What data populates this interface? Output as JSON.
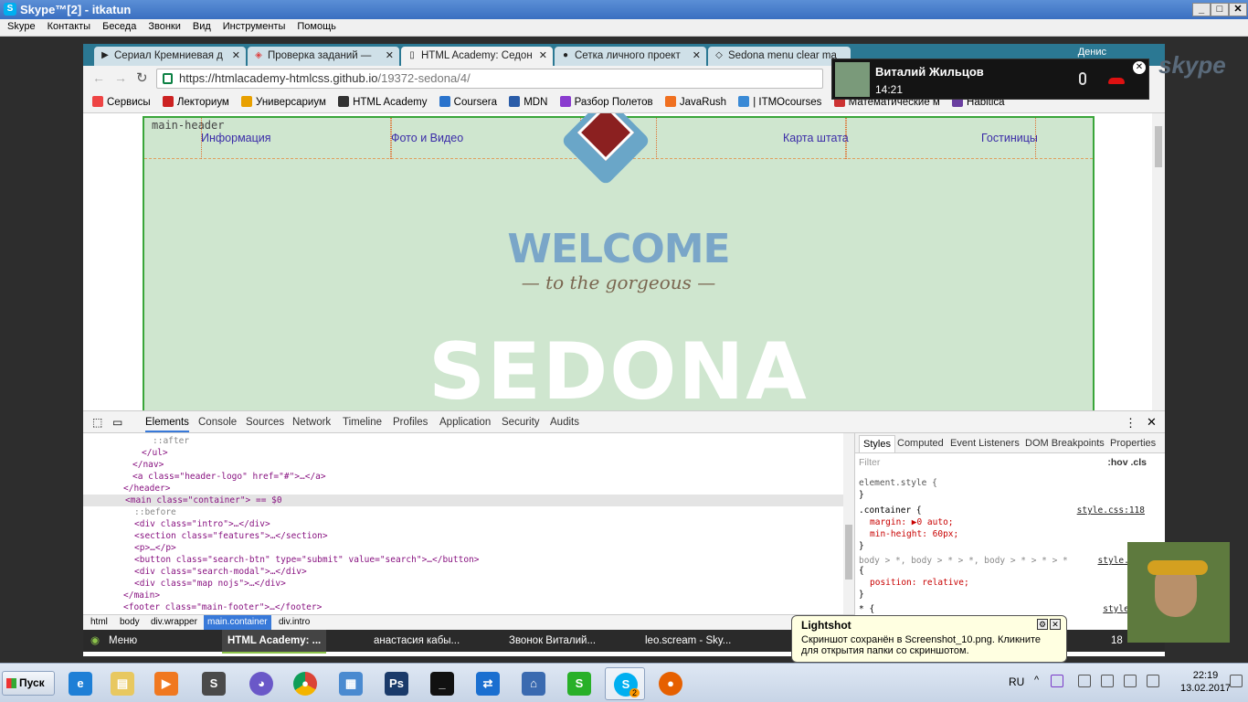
{
  "skype": {
    "title": "Skype™[2] - itkatun",
    "logo_letter": "S",
    "menu": [
      "Skype",
      "Контакты",
      "Беседа",
      "Звонки",
      "Вид",
      "Инструменты",
      "Помощь"
    ],
    "call": {
      "name": "Виталий Жильцов",
      "time": "14:21"
    },
    "logo_text": "skype"
  },
  "chrome": {
    "tabs": [
      {
        "label": "Сериал Кремниевая д",
        "icon": "play-icon"
      },
      {
        "label": "Проверка заданий —",
        "icon": "shield-icon"
      },
      {
        "label": "HTML Academy: Седон",
        "icon": "doc-icon",
        "active": true
      },
      {
        "label": "Сетка личного проект",
        "icon": "github-icon"
      },
      {
        "label": "Sedona menu clear ma",
        "icon": "codepen-icon"
      }
    ],
    "profile": "Денис",
    "url_main": "https://htmlacademy-htmlcss.github.io",
    "url_rest": "/19372-sedona/4/",
    "bookmarks": [
      {
        "label": "Сервисы",
        "color": "#e44"
      },
      {
        "label": "Лекториум",
        "color": "#c22"
      },
      {
        "label": "Универсариум",
        "color": "#e8a000"
      },
      {
        "label": "HTML Academy",
        "color": "#333"
      },
      {
        "label": "Coursera",
        "color": "#2a73cc"
      },
      {
        "label": "MDN",
        "color": "#2a5ca8"
      },
      {
        "label": "Разбор Полетов",
        "color": "#8a3ccf"
      },
      {
        "label": "JavaRush",
        "color": "#f07020"
      },
      {
        "label": "| ITMOcourses",
        "color": "#3a8ad6"
      },
      {
        "label": "Математические м",
        "color": "#c33"
      },
      {
        "label": "Habitica",
        "color": "#6a3fa0"
      }
    ]
  },
  "page": {
    "header_label": "main-header",
    "nav": [
      "Информация",
      "Фото и Видео",
      "Карта штата",
      "Гостиницы"
    ],
    "welcome": "WELCOME",
    "gorgeous": "— to the gorgeous —",
    "sedona": "SEDONA"
  },
  "devtools": {
    "tabs": [
      "Elements",
      "Console",
      "Sources",
      "Network",
      "Timeline",
      "Profiles",
      "Application",
      "Security",
      "Audits"
    ],
    "lines": [
      "::after",
      "</ul>",
      "</nav>",
      "<a class=\"header-logo\" href=\"#\">…</a>",
      "</header>",
      "<main class=\"container\"> == $0",
      "::before",
      "<div class=\"intro\">…</div>",
      "<section class=\"features\">…</section>",
      "<p>…</p>",
      "<button class=\"search-btn\" type=\"submit\" value=\"search\">…</button>",
      "<div class=\"search-modal\">…</div>",
      "<div class=\"map nojs\">…</div>",
      "</main>",
      "<footer class=\"main-footer\">…</footer>"
    ],
    "breadcrumbs": [
      "html",
      "body",
      "div.wrapper",
      "main.container",
      "div.intro"
    ],
    "styles_tabs": [
      "Styles",
      "Computed",
      "Event Listeners",
      "DOM Breakpoints",
      "Properties"
    ],
    "filter_placeholder": "Filter",
    "filter_buttons": ":hov  .cls",
    "rules": {
      "element_style": "element.style {",
      "container_sel": ".container {",
      "container_src": "style.css:118",
      "margin": "margin: ▶0 auto;",
      "min_height": "min-height: 60px;",
      "body_sel": "body > *, body > * > *, body > * > * > *",
      "body_src": "style.css",
      "position": "position: relative;",
      "star": "* {",
      "star_src": "style.cs"
    }
  },
  "inner_taskbar": [
    "Меню",
    "HTML Academy: ...",
    "анастасия кабы...",
    "Звонок Виталий...",
    "leo.scream - Sky...",
    "18"
  ],
  "lightshot": {
    "title": "Lightshot",
    "text": "Скриншот сохранён в Screenshot_10.png. Кликните для открытия папки со скриншотом."
  },
  "taskbar": {
    "start": "Пуск",
    "lang": "RU",
    "time": "22:19",
    "date": "13.02.2017",
    "skype_badge": "2"
  }
}
